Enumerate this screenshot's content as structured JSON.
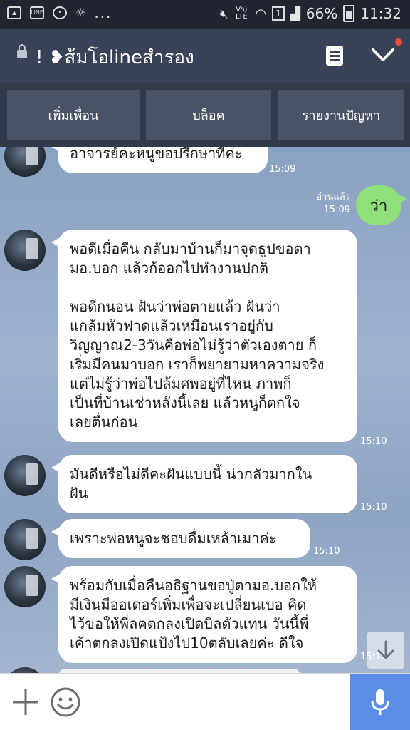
{
  "status_bar": {
    "network_label": "Vo) LTE",
    "sim_slot": "1",
    "battery": "66%",
    "time": "11:32",
    "icons": [
      "image-icon",
      "line-icon",
      "chat-icon",
      "weather-icon",
      "mute-icon",
      "wifi-icon",
      "signal-icon",
      "battery-icon"
    ]
  },
  "header": {
    "title": "! ❥ส้มโอlineสำรอง",
    "icons": [
      "lock-icon",
      "menu-icon",
      "chevron-down-icon"
    ],
    "notification_color": "#f24a3d"
  },
  "actions": {
    "add_friend": "เพิ่มเพื่อน",
    "block": "บล็อค",
    "report": "รายงานปัญหา"
  },
  "messages": [
    {
      "sender": "friend",
      "lines": [
        "อาจารย์คะหนูขอปรึกษาที่ค่ะ"
      ],
      "time": "15:09"
    },
    {
      "sender": "me",
      "text": "ว่า",
      "read_label": "อ่านแล้ว",
      "time": "15:09"
    },
    {
      "sender": "friend",
      "lines": [
        "พอดีเมื่อคืน กลับมาบ้านก็มาจุดธูปขอตา",
        "มอ.บอก แล้วก้ออกไปทำงานปกติ",
        "",
        "พอดีกนอน ฝันว่าพ่อตายแล้ว ฝันว่า",
        "แกล้มหัวฟาดแล้วเหมือนเราอยู่กับ",
        "วิญญาณ2-3วันคือพ่อไม่รู้ว่าตัวเองตาย ก็",
        "เริ่มมีคนมาบอก เราก็พยายามหาความจริง",
        "แต่ไม่รู้ว่าพ่อไปล้มศพอยู่ที่ไหน ภาพก็",
        "เป็นที่บ้านเช่าหลังนี้เลย แล้วหนูก็ตกใจ",
        "เลยตื่นก่อน"
      ],
      "time": "15:10"
    },
    {
      "sender": "friend",
      "lines": [
        "มันดีหรือไม่ดีคะฝันแบบนี้ น่ากลัวมากใน",
        "ฝัน"
      ],
      "time": "15:10"
    },
    {
      "sender": "friend",
      "lines": [
        "เพราะพ่อหนูจะชอบดื่มเหล้าเมาค่ะ"
      ],
      "time": "15:10"
    },
    {
      "sender": "friend",
      "lines": [
        "พร้อมกับเมื่อคืนอธิฐานขอปู่ตามอ.บอกให้",
        "มีเงินมีออเดอร์เพิ่มเพื่อจะเปลี่ยนเบอ คิด",
        "ไว้ขอให้พี่ลคตกลงเปิดบิลตัวแทน วันนี้พี่",
        "เค้าตกลงเปิดแป้งไป10ตลับเลยค่ะ ดีใจ"
      ],
      "time": "15:10"
    }
  ],
  "input_bar": {
    "icons": [
      "plus-icon",
      "smile-icon",
      "microphone-icon"
    ],
    "mic_color": "#5a8de6"
  },
  "colors": {
    "header_bg": "#3a4257",
    "sent_bubble": "#8fe07a",
    "received_bubble": "#ffffff"
  }
}
